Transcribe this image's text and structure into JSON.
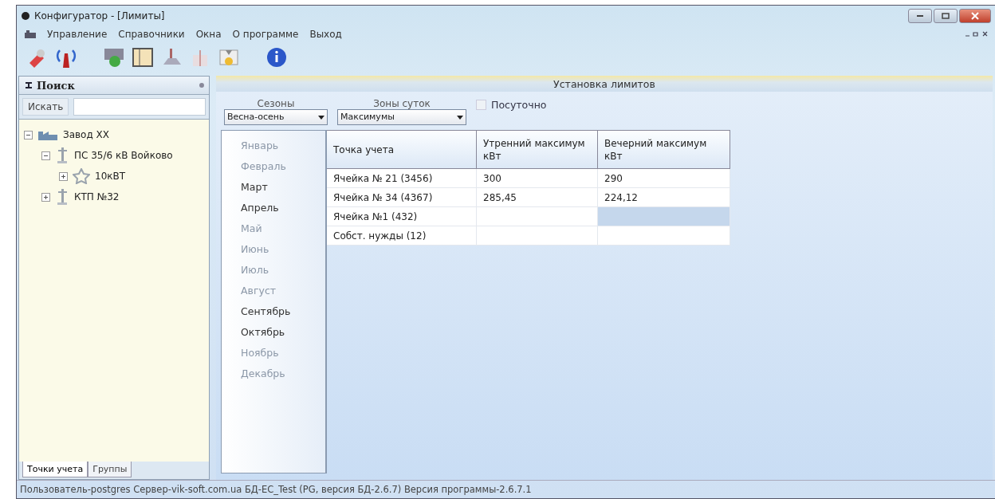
{
  "window": {
    "title": "Конфигуратор - [Лимиты]"
  },
  "menu": [
    "Управление",
    "Справочники",
    "Окна",
    "О программе",
    "Выход"
  ],
  "search_panel": {
    "title": "Поиск",
    "search_button": "Искать",
    "tree": [
      {
        "label": "Завод ХХ",
        "kind": "factory",
        "expanded": true,
        "children": [
          {
            "label": "ПС 35/6 кВ Войково",
            "kind": "pole",
            "expanded": true,
            "children": [
              {
                "label": "10кВТ",
                "kind": "star",
                "expanded": false
              }
            ]
          },
          {
            "label": "КТП №32",
            "kind": "pole",
            "expanded": false
          }
        ]
      }
    ],
    "tabs": [
      {
        "label": "Точки учета",
        "selected": true
      },
      {
        "label": "Группы",
        "selected": false
      }
    ]
  },
  "limits": {
    "title": "Установка лимитов",
    "seasons": {
      "label": "Сезоны",
      "value": "Весна-осень"
    },
    "zones": {
      "label": "Зоны суток",
      "value": "Максимумы"
    },
    "daily": {
      "label": "Посуточно",
      "checked": false
    },
    "months": [
      {
        "label": "Январь",
        "disabled": true
      },
      {
        "label": "Февраль",
        "disabled": true
      },
      {
        "label": "Март",
        "disabled": false
      },
      {
        "label": "Апрель",
        "disabled": false
      },
      {
        "label": "Май",
        "disabled": true
      },
      {
        "label": "Июнь",
        "disabled": true
      },
      {
        "label": "Июль",
        "disabled": true
      },
      {
        "label": "Август",
        "disabled": true
      },
      {
        "label": "Сентябрь",
        "disabled": false
      },
      {
        "label": "Октябрь",
        "disabled": false
      },
      {
        "label": "Ноябрь",
        "disabled": true
      },
      {
        "label": "Декабрь",
        "disabled": true
      }
    ],
    "table": {
      "columns": [
        "Точка учета",
        "Утренний максимум кВт",
        "Вечерний максимум кВт"
      ],
      "rows": [
        {
          "cells": [
            {
              "text": "Ячейка № 21 (3456)",
              "selected": false
            },
            {
              "text": "300",
              "selected": false
            },
            {
              "text": "290",
              "selected": false
            }
          ]
        },
        {
          "cells": [
            {
              "text": "Ячейка № 34 (4367)",
              "selected": false
            },
            {
              "text": "285,45",
              "selected": false
            },
            {
              "text": "224,12",
              "selected": false
            }
          ]
        },
        {
          "cells": [
            {
              "text": "Ячейка №1 (432)",
              "selected": false
            },
            {
              "selected": false
            },
            {
              "selected": true
            }
          ]
        },
        {
          "cells": [
            {
              "text": "Собст. нужды (12)",
              "selected": false
            },
            {
              "selected": false
            },
            {
              "selected": false
            }
          ]
        }
      ]
    }
  },
  "status_bar": "Пользователь-postgres Сервер-vik-soft.com.ua БД-EC_Test (PG, версия БД-2.6.7) Версия программы-2.6.7.1"
}
